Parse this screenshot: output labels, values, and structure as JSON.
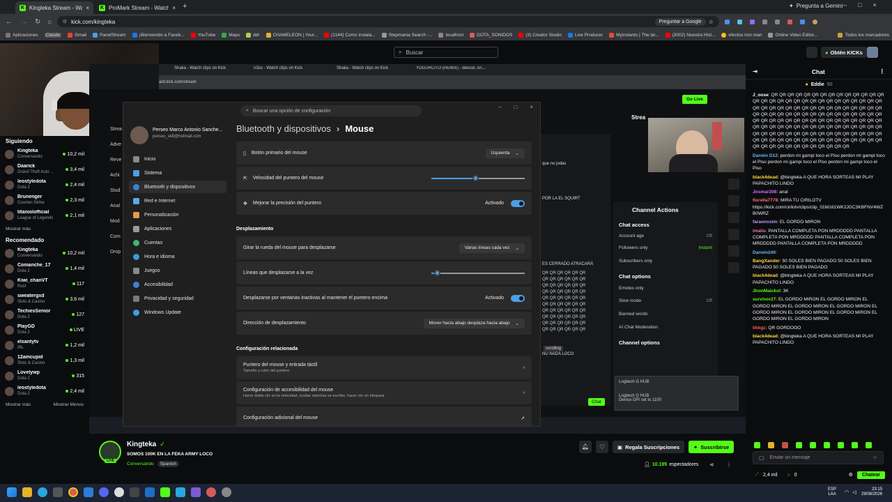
{
  "browser": {
    "tabs": [
      {
        "label": "Kingteka Stream - Watch Li"
      },
      {
        "label": "ProMark Stream - Watch Live c"
      }
    ],
    "new_tab": "+",
    "url": "kick.com/kingteka",
    "ask_google": "Preguntar a Google",
    "ask_gemini": "Pregunta a Gemini",
    "bookmarks": [
      "Aplicaciones",
      "Claude",
      "Gmail",
      "PanelStream",
      "¡Bienvenido a Faceb...",
      "YouTube",
      "Maps",
      "ddr",
      "CHAMELEON | Your...",
      "(1144) Como instala...",
      "Stepmania Search -...",
      "localhost",
      "DOTA_SONIDOS",
      "(3) Creator Studio",
      "Live Producer",
      "Myinstants | The lar...",
      "(3002) Nuestra Hist...",
      "efectos iron man",
      "Online Video Editor..."
    ],
    "all_bookmarks": "Todos los marcadores",
    "colors": {
      "kick_green": "#53fc18",
      "accent_blue": "#4a9ee8"
    }
  },
  "kick": {
    "search_placeholder": "Buscar",
    "get_kicks": "Obtén KICKs",
    "sidebar": {
      "following_title": "Siguiendo",
      "following": [
        {
          "name": "Kingteka",
          "category": "Conversando",
          "viewers": "10,2 mil"
        },
        {
          "name": "Daarick",
          "category": "Grand Theft Auto ...",
          "viewers": "3,4 mil"
        },
        {
          "name": "leostyledota",
          "category": "Dota 2",
          "viewers": "2,4 mil"
        },
        {
          "name": "Brunenger",
          "category": "Counter-Strike",
          "viewers": "2,3 mil"
        },
        {
          "name": "titaniolofficial",
          "category": "League of Legends",
          "viewers": "2,1 mil"
        }
      ],
      "show_more": "Mostrar más",
      "recommended_title": "Recomendado",
      "recommended": [
        {
          "name": "Kingteka",
          "category": "Conversando",
          "viewers": "10,2 mil"
        },
        {
          "name": "Comanche_17",
          "category": "Dota 2",
          "viewers": "1,4 mil"
        },
        {
          "name": "Kiwi_chanVT",
          "category": "Rust",
          "viewers": "117"
        },
        {
          "name": "sweatergxd",
          "category": "Slots & Casino",
          "viewers": "3,6 mil"
        },
        {
          "name": "TechiesSenior",
          "category": "Dota 2",
          "viewers": "127"
        },
        {
          "name": "PlayGD",
          "category": "Dota 2",
          "viewers": "LIVE"
        },
        {
          "name": "elsantytv",
          "category": "IRL",
          "viewers": "1,2 mil"
        },
        {
          "name": "12amcupid",
          "category": "Slots & Casino",
          "viewers": "1,3 mil"
        },
        {
          "name": "Lovelywp",
          "category": "Dota 2",
          "viewers": "315"
        },
        {
          "name": "leostyledota",
          "category": "Dota 2",
          "viewers": "2,4 mil"
        }
      ],
      "show_more_2": "Mostrar más",
      "show_less": "Mostrar Menos"
    },
    "channel": {
      "name": "Kingteka",
      "title": "SOMOS 100K EN LA FEKA ARMY LOCO",
      "category": "Conversando",
      "language": "Spanish",
      "live_badge": "LIVE",
      "gift_subs": "Regala Suscripciones",
      "subscribe": "Suscribirse",
      "viewers": "10.195",
      "viewers_label": "espectadores"
    },
    "chat": {
      "title": "Chat",
      "pinned_user": "Eddie",
      "pinned_count": "50",
      "messages": [
        {
          "user": "J_oose",
          "color": "#ffffff",
          "text": "QR QR QR QR QR QR QR QR QR QR QR QR QR QR QR QR QR QR QR QR QR QR QR QR QR QR QR QR QR QR QR QR QR QR QR QR QR QR QR QR QR QR QR QR QR QR QR QR QR QR QR QR QR QR QR QR QR QR QR QR QR QR QR QR QR QR QR QR QR QR QR QR QR QR QR QR QR QR QR QR QR QR QR QR QR QR QR QR QR QR QR QR QR QR QR QR QR QR QR QR QR QR QR QR QR QR QR QR QR QR QR QR QR QR QR QR QR QR QR QR QR QR QR QR QR QR QR QR QR QR QR QR QR QR QR QR QR QR"
        },
        {
          "user": "Darwin D12",
          "color": "#69b6ff",
          "text": "perdon mi gampi toco el Piso perdon mi gampi toco el Piso perdon mi gampi toco el Piso perdon mi gampi toco el Piso"
        },
        {
          "user": "black4dead",
          "color": "#ffd83a",
          "text": "@kingteka A QUE HORA SORTEAS MI PLAY PAPACHITO LINDO"
        },
        {
          "user": "Josmar208",
          "color": "#d96cff",
          "text": "anal"
        },
        {
          "user": "fiorella7778",
          "color": "#ff6b8a",
          "text": "MIRA TU CIRILOTV https://kick.com/cirilotv/clips/clip_01M161WK2JGC3KBFNV4WZB0WRZ"
        },
        {
          "user": "faraonxsim",
          "color": "#c59bff",
          "text": "EL GORDO MIRON"
        },
        {
          "user": "imalis",
          "color": "#ff6bb5",
          "text": "PANTALLA COMPLETA PON MRDDDDD PANTALLA COMPLETA PON MRDDDDD PANTALLA COMPLETA PON MRDDDDD PANTALLA COMPLETA PON MRDDDDD"
        },
        {
          "user": "Darwin240",
          "color": "#69b6ff",
          "text": ""
        },
        {
          "user": "BangXander",
          "color": "#ffd83a",
          "text": "50 SOLES BIEN PAGADO 50 SOLES BIEN PAGADO 50 SOLES BIEN PAGADO"
        },
        {
          "user": "black4dead",
          "color": "#ffd83a",
          "text": "@kingteka A QUE HORA SORTEAS MI PLAY PAPACHITO LINDO"
        },
        {
          "user": "JhonMaickol",
          "color": "#53fc18",
          "text": "3K"
        },
        {
          "user": "survivor27",
          "color": "#53fc18",
          "text": "EL GORDO MIRON EL GORDO MIRON EL GORDO MIRON EL GORDO MIRON EL GORDO MIRON EL GORDO MIRON EL GORDO MIRON EL GORDO MIRON EL GORDO MIRON EL GORDO MIRON"
        },
        {
          "user": "bkkgz",
          "color": "#ff5a5a",
          "text": "QR GORDOOO"
        },
        {
          "user": "black4dead",
          "color": "#ffd83a",
          "text": "@kingteka A QUE HORA SORTEAS MI PLAY PAPACHITO LINDO"
        }
      ],
      "input_placeholder": "Enviar un mensaje",
      "kicks_count": "2,4 mil",
      "points": "0",
      "send": "Chatear"
    }
  },
  "stream_window": {
    "tabs": [
      "Shaka - Watch clips on Kick",
      "n3os - Watch clips on Kick",
      "Shaka - Watch clips on Kick",
      "YOGURCITO (REMIX) - Blessd, An..."
    ],
    "url": "ard.kick.com/stream",
    "go_live": "Go Live",
    "stream_label": "Strea",
    "channel_actions": "Channel Actions",
    "chat_access": "Chat access",
    "account_age": "Account age",
    "off": "Off",
    "followers_only": "Followers only",
    "instant": "Instant",
    "subscribers_only": "Subscribers only",
    "chat_options": "Chat options",
    "emotes_only": "Emotes only",
    "slow_mode": "Slow mode",
    "banned_words": "Banned words",
    "ai_mod": "AI Chat Moderation",
    "channel_options": "Channel options",
    "notif_title": "Logitech G HUB",
    "notif_body": "Device DPI set to 1100",
    "mid_texts": [
      "que no jodas",
      "POR LA EL SQUIRT",
      "ES CERRADO ATRACARÁ",
      "QR QR QR QR QR QR",
      "scrolling",
      "NU NADA LOCO"
    ],
    "chat_btn": "Chat",
    "left_menu": [
      "Strea",
      "Adve",
      "Reve",
      "Achi",
      "Stud",
      "Anal",
      "Mod",
      "Com",
      "Drop"
    ]
  },
  "settings": {
    "search_placeholder": "Buscar una opción de configuración",
    "user_name": "Perseo Marco Antonio Sanche...",
    "user_email": "perseo_sk8@hotmail.com",
    "breadcrumb_parent": "Bluetooth y dispositivos",
    "breadcrumb_sep": "›",
    "breadcrumb_current": "Mouse",
    "nav": [
      "Inicio",
      "Sistema",
      "Bluetooth y dispositivos",
      "Red e Internet",
      "Personalización",
      "Aplicaciones",
      "Cuentas",
      "Hora e idioma",
      "Juegos",
      "Accesibilidad",
      "Privacidad y seguridad",
      "Windows Update"
    ],
    "primary_button": {
      "label": "Botón primario del mouse",
      "value": "Izquierda"
    },
    "pointer_speed": {
      "label": "Velocidad del puntero del mouse",
      "value": 0.47
    },
    "precision": {
      "label": "Mejorar la precisión del puntero",
      "value": "Activado"
    },
    "scroll_section": "Desplazamiento",
    "wheel": {
      "label": "Girar la rueda del mouse para desplazarse",
      "value": "Varias líneas cada vez"
    },
    "lines": {
      "label": "Líneas que desplazarse a la vez",
      "value": 0.06
    },
    "inactive": {
      "label": "Desplazarse por ventanas inactivas al mantener el puntero encima",
      "value": "Activado"
    },
    "direction": {
      "label": "Dirección de desplazamiento",
      "value": "Mover hacia abajo desplaza hacia abajo"
    },
    "related_section": "Configuración relacionada",
    "related": [
      {
        "label": "Puntero del mouse y entrada táctil",
        "sub": "Tamaño y color del puntero"
      },
      {
        "label": "Configuración de accesibilidad del mouse",
        "sub": "Hacer doble clic en la velocidad, ocultar mientras se escribe, hacer clic en bloquear"
      },
      {
        "label": "Configuración adicional del mouse",
        "sub": ""
      }
    ]
  },
  "taskbar": {
    "lang": "ESP",
    "lang2": "LAA",
    "time": "23:15",
    "date": "29/08/2026"
  }
}
